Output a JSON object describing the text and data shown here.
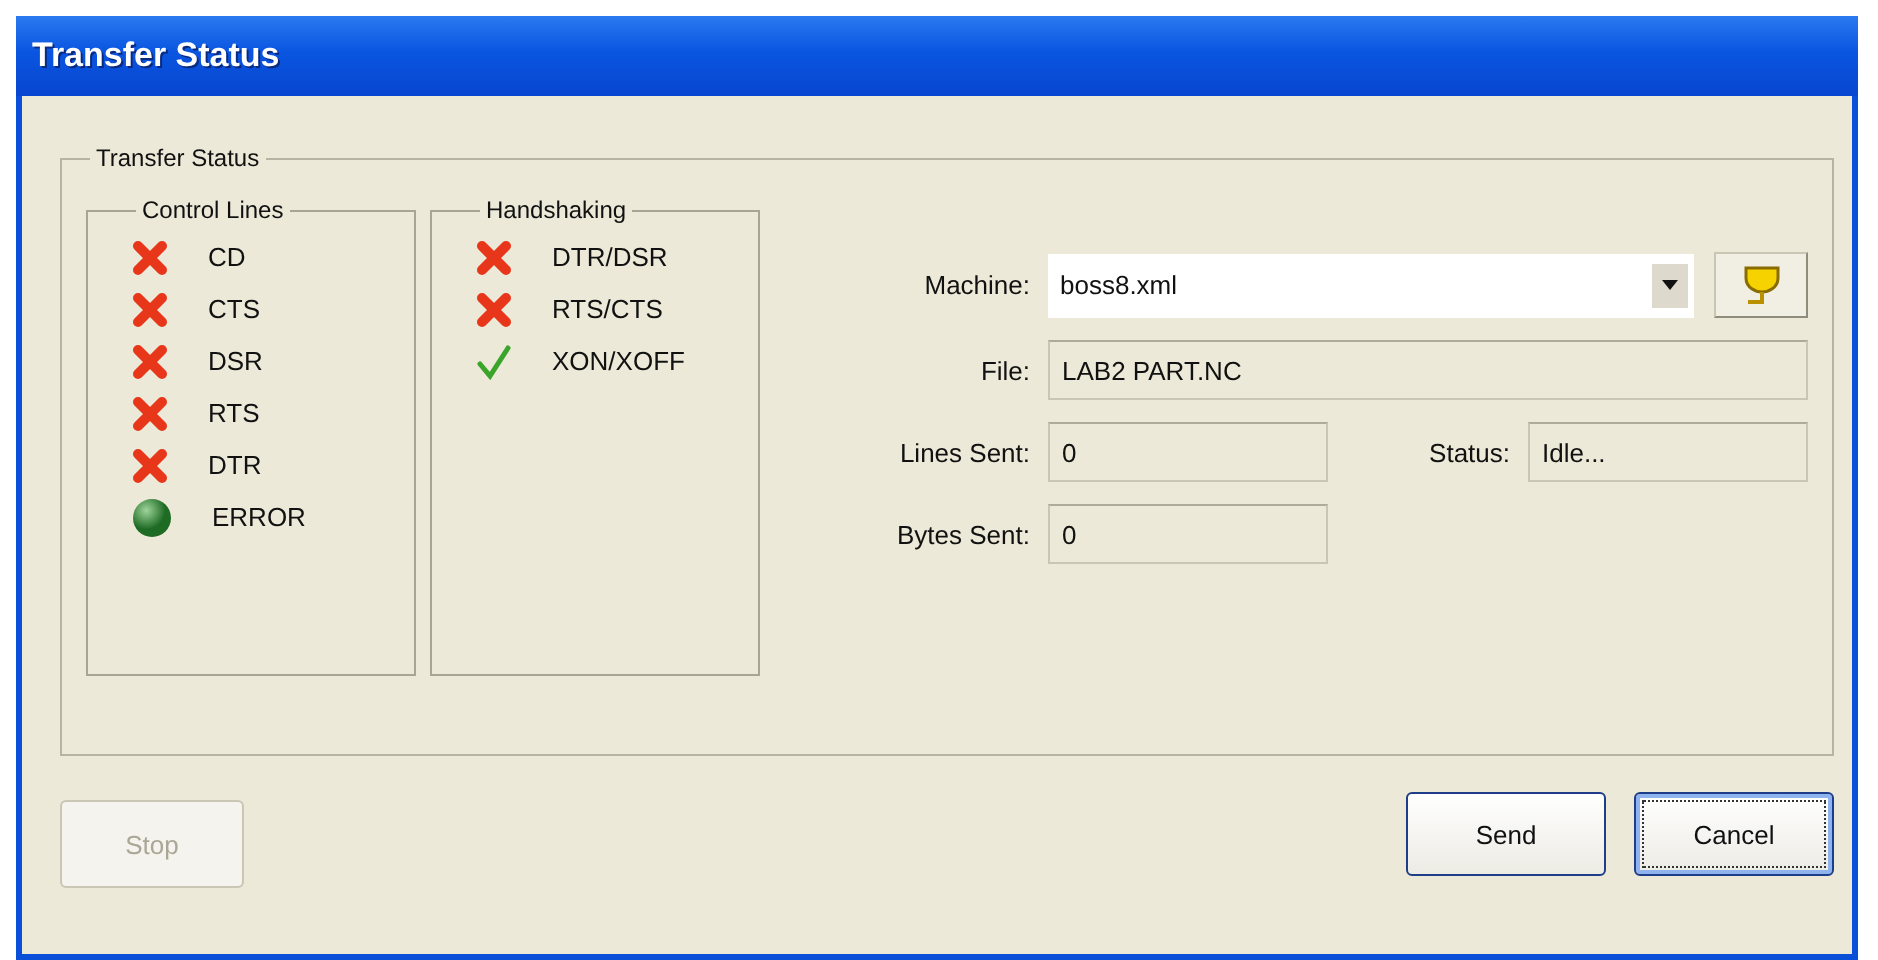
{
  "window": {
    "title": "Transfer Status"
  },
  "group_title": "Transfer Status",
  "control_lines": {
    "title": "Control Lines",
    "items": [
      {
        "label": "CD",
        "kind": "cross"
      },
      {
        "label": "CTS",
        "kind": "cross"
      },
      {
        "label": "DSR",
        "kind": "cross"
      },
      {
        "label": "RTS",
        "kind": "cross"
      },
      {
        "label": "DTR",
        "kind": "cross"
      },
      {
        "label": "ERROR",
        "kind": "led"
      }
    ]
  },
  "handshaking": {
    "title": "Handshaking",
    "items": [
      {
        "label": "DTR/DSR",
        "kind": "cross"
      },
      {
        "label": "RTS/CTS",
        "kind": "cross"
      },
      {
        "label": "XON/XOFF",
        "kind": "check"
      }
    ]
  },
  "machine": {
    "label": "Machine:",
    "value": "boss8.xml"
  },
  "file": {
    "label": "File:",
    "value": "LAB2 PART.NC"
  },
  "lines_sent": {
    "label": "Lines Sent:",
    "value": "0"
  },
  "status": {
    "label": "Status:",
    "value": "Idle..."
  },
  "bytes_sent": {
    "label": "Bytes Sent:",
    "value": "0"
  },
  "buttons": [
    {
      "label": "Stop",
      "disabled": true,
      "focused": false
    },
    {
      "label": "Send",
      "disabled": false,
      "focused": false
    },
    {
      "label": "Cancel",
      "disabled": false,
      "focused": true
    }
  ]
}
